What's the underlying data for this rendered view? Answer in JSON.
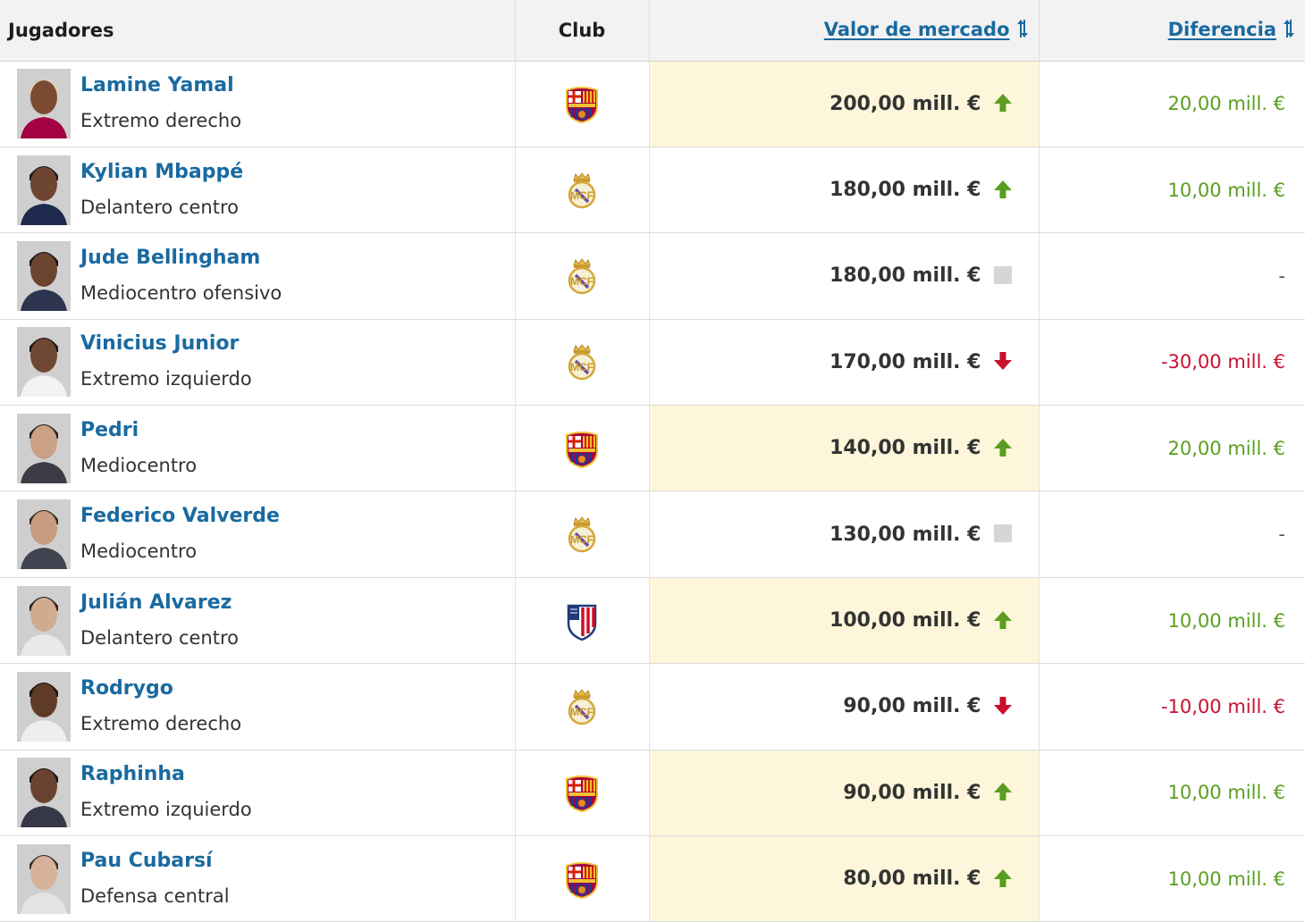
{
  "headers": {
    "player": "Jugadores",
    "club": "Club",
    "value": "Valor de mercado",
    "diff": "Diferencia"
  },
  "colors": {
    "link": "#1a6aa0",
    "up": "#5a9e1f",
    "down": "#c8102e",
    "highlight": "#fdf6da"
  },
  "rows": [
    {
      "name": "Lamine Yamal",
      "position": "Extremo derecho",
      "club_icon": "fc-barcelona-crest-icon",
      "value": "200,00 mill. €",
      "trend": "up",
      "diff": "20,00 mill. €",
      "highlighted": true
    },
    {
      "name": "Kylian Mbappé",
      "position": "Delantero centro",
      "club_icon": "real-madrid-crest-icon",
      "value": "180,00 mill. €",
      "trend": "up",
      "diff": "10,00 mill. €",
      "highlighted": false
    },
    {
      "name": "Jude Bellingham",
      "position": "Mediocentro ofensivo",
      "club_icon": "real-madrid-crest-icon",
      "value": "180,00 mill. €",
      "trend": "none",
      "diff": "-",
      "highlighted": false
    },
    {
      "name": "Vinicius Junior",
      "position": "Extremo izquierdo",
      "club_icon": "real-madrid-crest-icon",
      "value": "170,00 mill. €",
      "trend": "down",
      "diff": "-30,00 mill. €",
      "highlighted": false
    },
    {
      "name": "Pedri",
      "position": "Mediocentro",
      "club_icon": "fc-barcelona-crest-icon",
      "value": "140,00 mill. €",
      "trend": "up",
      "diff": "20,00 mill. €",
      "highlighted": true
    },
    {
      "name": "Federico Valverde",
      "position": "Mediocentro",
      "club_icon": "real-madrid-crest-icon",
      "value": "130,00 mill. €",
      "trend": "none",
      "diff": "-",
      "highlighted": false
    },
    {
      "name": "Julián Alvarez",
      "position": "Delantero centro",
      "club_icon": "atletico-madrid-crest-icon",
      "value": "100,00 mill. €",
      "trend": "up",
      "diff": "10,00 mill. €",
      "highlighted": true
    },
    {
      "name": "Rodrygo",
      "position": "Extremo derecho",
      "club_icon": "real-madrid-crest-icon",
      "value": "90,00 mill. €",
      "trend": "down",
      "diff": "-10,00 mill. €",
      "highlighted": false
    },
    {
      "name": "Raphinha",
      "position": "Extremo izquierdo",
      "club_icon": "fc-barcelona-crest-icon",
      "value": "90,00 mill. €",
      "trend": "up",
      "diff": "10,00 mill. €",
      "highlighted": true
    },
    {
      "name": "Pau Cubarsí",
      "position": "Defensa central",
      "club_icon": "fc-barcelona-crest-icon",
      "value": "80,00 mill. €",
      "trend": "up",
      "diff": "10,00 mill. €",
      "highlighted": true
    }
  ]
}
